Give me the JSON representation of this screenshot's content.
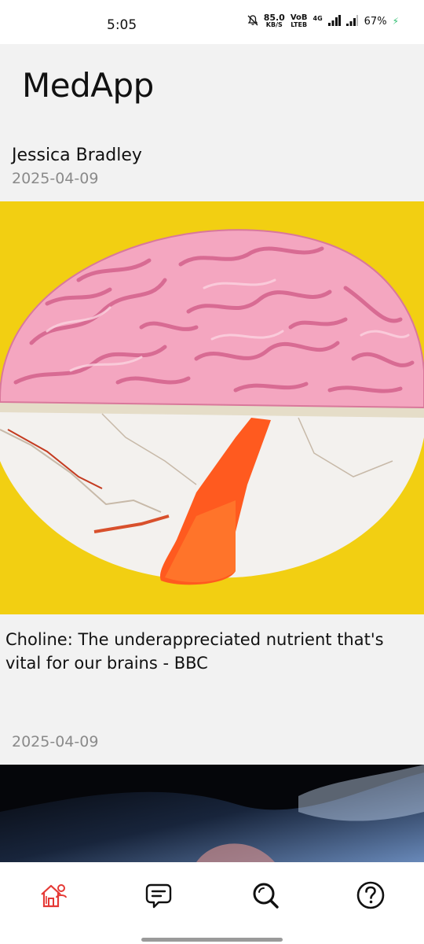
{
  "status_bar": {
    "time": "5:05",
    "speed_value": "85.0",
    "speed_unit": "KB/S",
    "volte_top": "VoB",
    "volte_bottom": "LTEB",
    "network": "4G",
    "battery": "67%"
  },
  "app": {
    "title": "MedApp"
  },
  "post": {
    "author": "Jessica Bradley",
    "date_top": "2025-04-09",
    "title": "Choline: The underappreciated nutrient that's vital for our brains - BBC",
    "date_bottom": "2025-04-09"
  },
  "colors": {
    "accent": "#e53935",
    "image_background": "#f2cf12",
    "secondary_text": "#8a8a8a"
  },
  "bottom_nav": {
    "items": [
      {
        "icon": "home-icon",
        "active": true
      },
      {
        "icon": "chat-icon",
        "active": false
      },
      {
        "icon": "search-icon",
        "active": false
      },
      {
        "icon": "help-icon",
        "active": false
      }
    ]
  }
}
